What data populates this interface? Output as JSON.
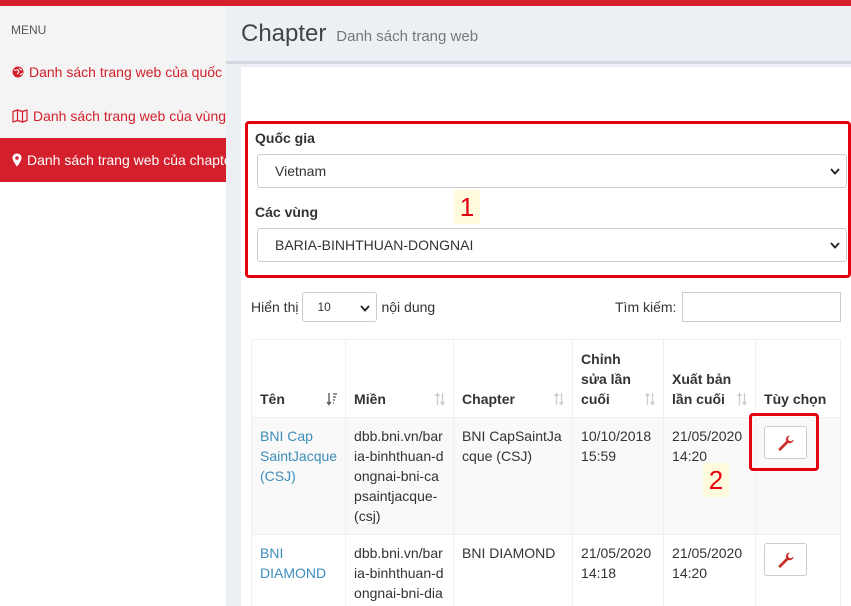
{
  "sidebar": {
    "menu_label": "MENU",
    "items": [
      {
        "label": "Danh sách trang web của quốc gia",
        "icon": "globe-icon"
      },
      {
        "label": "Danh sách trang web của vùng",
        "icon": "map-icon"
      },
      {
        "label": "Danh sách trang web của chapter",
        "icon": "map-marker-icon",
        "active": true
      }
    ]
  },
  "header": {
    "title": "Chapter",
    "subtitle": "Danh sách trang web"
  },
  "filters": {
    "country_label": "Quốc gia",
    "country_value": "Vietnam",
    "region_label": "Các vùng",
    "region_value": "BARIA-BINHTHUAN-DONGNAI"
  },
  "annotations": {
    "first": "1",
    "second": "2"
  },
  "table_controls": {
    "show_label": "Hiển thị",
    "length_value": "10",
    "entries_label": "nội dung",
    "search_label": "Tìm kiếm:"
  },
  "table": {
    "columns": [
      "Tên",
      "Miền",
      "Chapter",
      "Chỉnh sửa lần cuối",
      "Xuất bản lần cuối",
      "Tùy chọn"
    ],
    "rows": [
      {
        "name": "BNI Cap SaintJacque (CSJ)",
        "domain": "dbb.bni.vn/baria-binhthuan-dongnai-bni-capsaintjacque-(csj)",
        "chapter": "BNI CapSaintJacque (CSJ)",
        "edited": "10/10/2018 15:59",
        "published": "21/05/2020 14:20"
      },
      {
        "name": "BNI DIAMOND",
        "domain": "dbb.bni.vn/baria-binhthuan-dongnai-bni-diamond",
        "chapter": "BNI DIAMOND",
        "edited": "21/05/2020 14:18",
        "published": "21/05/2020 14:20"
      }
    ]
  },
  "colors": {
    "brand": "#d3202c",
    "link": "#3c8dbc",
    "highlight": "#e3000f"
  }
}
